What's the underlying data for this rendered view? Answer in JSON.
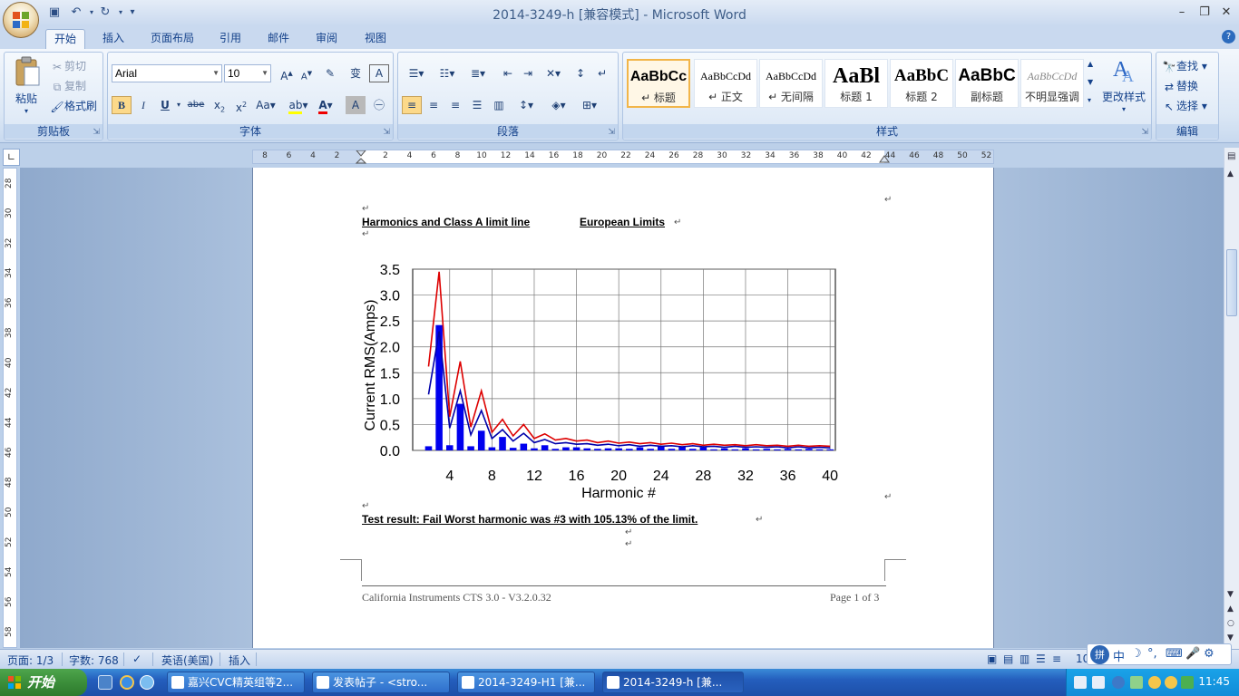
{
  "window": {
    "title": "2014-3249-h [兼容模式] - Microsoft Word"
  },
  "ribbon": {
    "tabs": [
      "开始",
      "插入",
      "页面布局",
      "引用",
      "邮件",
      "审阅",
      "视图"
    ],
    "clipboard": {
      "paste": "粘贴",
      "cut": "剪切",
      "copy": "复制",
      "format_painter": "格式刷",
      "label": "剪贴板"
    },
    "font": {
      "name": "Arial",
      "size": "10",
      "label": "字体"
    },
    "paragraph": {
      "label": "段落"
    },
    "styles": {
      "label": "样式",
      "change_styles": "更改样式",
      "items": [
        {
          "sample": "AaBbCc",
          "name": "↵ 标题"
        },
        {
          "sample": "AaBbCcDd",
          "name": "↵ 正文"
        },
        {
          "sample": "AaBbCcDd",
          "name": "↵ 无间隔"
        },
        {
          "sample": "AaBl",
          "name": "标题 1"
        },
        {
          "sample": "AaBbC",
          "name": "标题 2"
        },
        {
          "sample": "AaBbC",
          "name": "副标题"
        },
        {
          "sample": "AaBbCcDd",
          "name": "不明显强调"
        }
      ]
    },
    "editing": {
      "find": "查找",
      "replace": "替换",
      "select": "选择",
      "label": "编辑"
    }
  },
  "ruler": {
    "h_ticks": [
      "8",
      "6",
      "4",
      "2",
      "2",
      "4",
      "6",
      "8",
      "10",
      "12",
      "14",
      "16",
      "18",
      "20",
      "22",
      "24",
      "26",
      "28",
      "30",
      "32",
      "34",
      "36",
      "38",
      "40",
      "42",
      "44",
      "46",
      "48",
      "50",
      "52"
    ],
    "v_ticks": [
      "28",
      "30",
      "32",
      "34",
      "36",
      "38",
      "40",
      "42",
      "44",
      "46",
      "48",
      "50",
      "52",
      "54",
      "56",
      "58"
    ]
  },
  "document": {
    "heading_left": "Harmonics and Class A limit line",
    "heading_right": "European Limits",
    "test_result": "Test result:  Fail     Worst harmonic was #3 with 105.13% of the limit.",
    "footer_left": "California Instruments CTS 3.0 - V3.2.0.32",
    "footer_right": "Page 1 of 3"
  },
  "chart_data": {
    "type": "bar",
    "xlabel": "Harmonic #",
    "ylabel": "Current RMS(Amps)",
    "xlim": [
      0.5,
      40.5
    ],
    "ylim": [
      0,
      3.5
    ],
    "x_ticks": [
      4,
      8,
      12,
      16,
      20,
      24,
      28,
      32,
      36,
      40
    ],
    "y_ticks": [
      "0.0",
      "0.5",
      "1.0",
      "1.5",
      "2.0",
      "2.5",
      "3.0",
      "3.5"
    ],
    "grid": true,
    "x": [
      2,
      3,
      4,
      5,
      6,
      7,
      8,
      9,
      10,
      11,
      12,
      13,
      14,
      15,
      16,
      17,
      18,
      19,
      20,
      21,
      22,
      23,
      24,
      25,
      26,
      27,
      28,
      29,
      30,
      31,
      32,
      33,
      34,
      35,
      36,
      37,
      38,
      39,
      40
    ],
    "series": [
      {
        "kind": "bar",
        "color": "#0000ee",
        "values": [
          0.08,
          2.42,
          0.1,
          0.9,
          0.08,
          0.38,
          0.06,
          0.26,
          0.05,
          0.13,
          0.04,
          0.1,
          0.03,
          0.06,
          0.06,
          0.04,
          0.03,
          0.04,
          0.04,
          0.03,
          0.06,
          0.03,
          0.07,
          0.03,
          0.08,
          0.03,
          0.06,
          0.02,
          0.04,
          0.02,
          0.04,
          0.02,
          0.03,
          0.02,
          0.03,
          0.02,
          0.03,
          0.02,
          0.02
        ]
      },
      {
        "kind": "line",
        "color": "#0000aa",
        "values": [
          1.08,
          2.3,
          0.43,
          1.15,
          0.3,
          0.77,
          0.23,
          0.4,
          0.18,
          0.33,
          0.15,
          0.21,
          0.13,
          0.15,
          0.12,
          0.13,
          0.1,
          0.12,
          0.09,
          0.11,
          0.08,
          0.1,
          0.08,
          0.09,
          0.07,
          0.09,
          0.07,
          0.08,
          0.06,
          0.08,
          0.06,
          0.07,
          0.06,
          0.07,
          0.05,
          0.07,
          0.05,
          0.06,
          0.05
        ]
      },
      {
        "kind": "line",
        "color": "#dd0000",
        "values": [
          1.62,
          3.45,
          0.65,
          1.72,
          0.45,
          1.15,
          0.35,
          0.6,
          0.28,
          0.5,
          0.23,
          0.32,
          0.2,
          0.23,
          0.18,
          0.2,
          0.15,
          0.18,
          0.14,
          0.16,
          0.13,
          0.15,
          0.12,
          0.14,
          0.11,
          0.13,
          0.1,
          0.12,
          0.1,
          0.11,
          0.09,
          0.11,
          0.09,
          0.1,
          0.08,
          0.1,
          0.08,
          0.09,
          0.08
        ]
      }
    ]
  },
  "status": {
    "page": "页面: 1/3",
    "words": "字数: 768",
    "language": "英语(美国)",
    "mode": "插入",
    "zoom": "10"
  },
  "taskbar": {
    "start": "开始",
    "tasks": [
      "嘉兴CVC精英组等2...",
      "发表帖子 - <stro...",
      "2014-3249-H1 [兼...",
      "2014-3249-h [兼..."
    ],
    "clock": "11:45"
  },
  "colors": {
    "accent": "#15428b",
    "ribbon": "#dbe7f5",
    "taskbar": "#245ebd"
  }
}
